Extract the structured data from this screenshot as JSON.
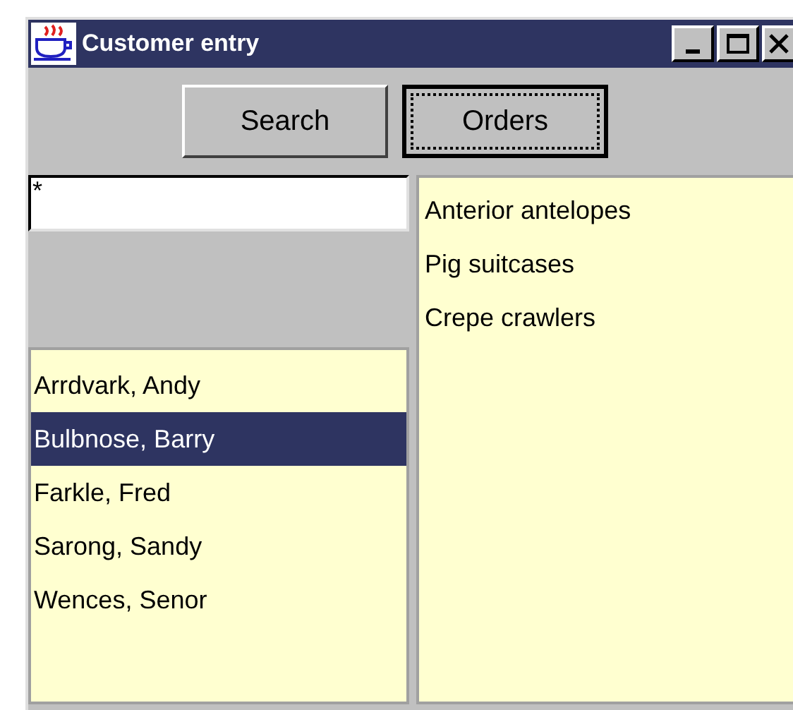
{
  "window": {
    "title": "Customer entry"
  },
  "buttons": [
    {
      "label": "Search",
      "focused": false
    },
    {
      "label": "Orders",
      "focused": true
    }
  ],
  "search": {
    "value": "*"
  },
  "customers": [
    {
      "name": "Arrdvark, Andy",
      "selected": false
    },
    {
      "name": "Bulbnose, Barry",
      "selected": true
    },
    {
      "name": "Farkle, Fred",
      "selected": false
    },
    {
      "name": "Sarong, Sandy",
      "selected": false
    },
    {
      "name": "Wences, Senor",
      "selected": false
    }
  ],
  "orders": [
    "Anterior antelopes",
    "Pig suitcases",
    "Crepe crawlers"
  ]
}
